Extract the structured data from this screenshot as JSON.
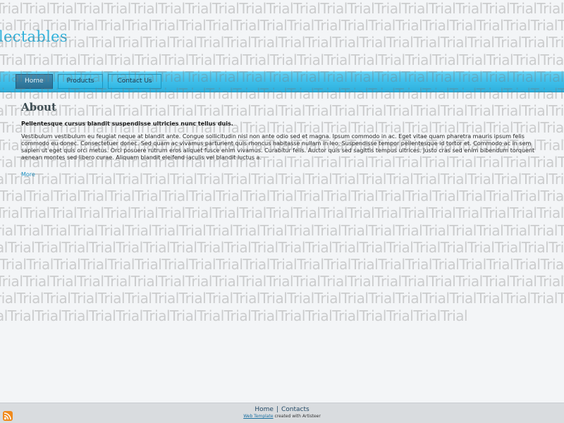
{
  "header": {
    "title": "lectables"
  },
  "nav": {
    "items": [
      {
        "label": "Home",
        "active": true
      },
      {
        "label": "Products",
        "active": false
      },
      {
        "label": "Contact Us",
        "active": false
      }
    ]
  },
  "main": {
    "heading": "About",
    "lead": "Pellentesque cursus blandit suspendisse ultricies nunc tellus duis.",
    "body": "Vestibulum vestibulum eu feugiat neque at blandit ante. Congue sollicitudin nisl non ante odio sed et magna. Ipsum commodo in ac. Eget vitae quam pharetra mauris ipsum felis commodo eu donec. Consectetuer donec. Sed quam ac vivamus parturient quis rhoncus habitasse nullam in leo. Suspendisse tempor pellentesque id tortor et. Commodo ac in sem sapien ut eget quis orci metus. Orci posuere rutrum eros aliquet fusce enim vivamus. Curabitur felis. Auctor quis sed sagittis tempus ultrices. Justo cras sed enim bibendum torquent aenean montes sed libero curae. Aliquam blandit eleifend iaculis vel blandit luctus a.",
    "more": "More"
  },
  "footer": {
    "home": "Home",
    "separator": "|",
    "contacts": "Contacts",
    "template_link": "Web Template",
    "note": " created with Artisteer"
  },
  "watermark": {
    "word": "Trial"
  },
  "icons": {
    "rss": "rss-icon"
  },
  "colors": {
    "accent": "#2fb1db",
    "nav_band": "#3fc0ec",
    "nav_active": "#2b6f93",
    "footer_bg": "#d9dcdf",
    "rss": "#f08a1c"
  }
}
